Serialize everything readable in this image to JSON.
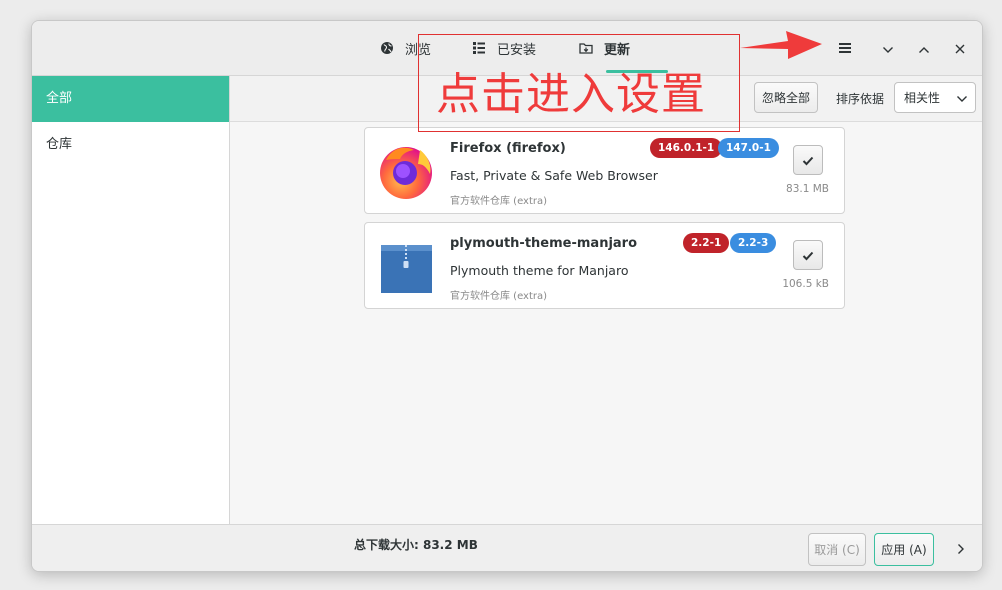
{
  "header": {
    "tabs": [
      {
        "label": "浏览",
        "icon": "globe-icon"
      },
      {
        "label": "已安装",
        "icon": "list-icon"
      },
      {
        "label": "更新",
        "icon": "folder-update-icon",
        "active": true
      }
    ],
    "menu_icon": "hamburger-menu-icon",
    "window_controls": [
      "minimize-icon",
      "maximize-icon",
      "close-icon"
    ]
  },
  "sidebar": {
    "items": [
      {
        "label": "全部",
        "selected": true
      },
      {
        "label": "仓库",
        "selected": false
      }
    ]
  },
  "toolbar": {
    "ignore_all_label": "忽略全部",
    "sort_label": "排序依据",
    "sort_value": "相关性"
  },
  "updates": [
    {
      "name": "Firefox (firefox)",
      "old_version": "146.0.1-1",
      "new_version": "147.0-1",
      "description": "Fast, Private & Safe Web Browser",
      "repo": "官方软件仓库 (extra)",
      "size": "83.1 MB",
      "icon": "firefox-icon",
      "checked": true
    },
    {
      "name": "plymouth-theme-manjaro",
      "old_version": "2.2-1",
      "new_version": "2.2-3",
      "description": "Plymouth theme for Manjaro",
      "repo": "官方软件仓库 (extra)",
      "size": "106.5 kB",
      "icon": "archive-package-icon",
      "checked": true
    }
  ],
  "footer": {
    "total_download": "总下载大小: 83.2 MB",
    "cancel_label": "取消 (C)",
    "apply_label": "应用 (A)"
  },
  "annotation": {
    "text": "点击进入设置"
  },
  "colors": {
    "accent": "#3bbf9f",
    "old_version_badge": "#c0232a",
    "new_version_badge": "#3a8de0",
    "annotation": "#ef3b3b"
  }
}
